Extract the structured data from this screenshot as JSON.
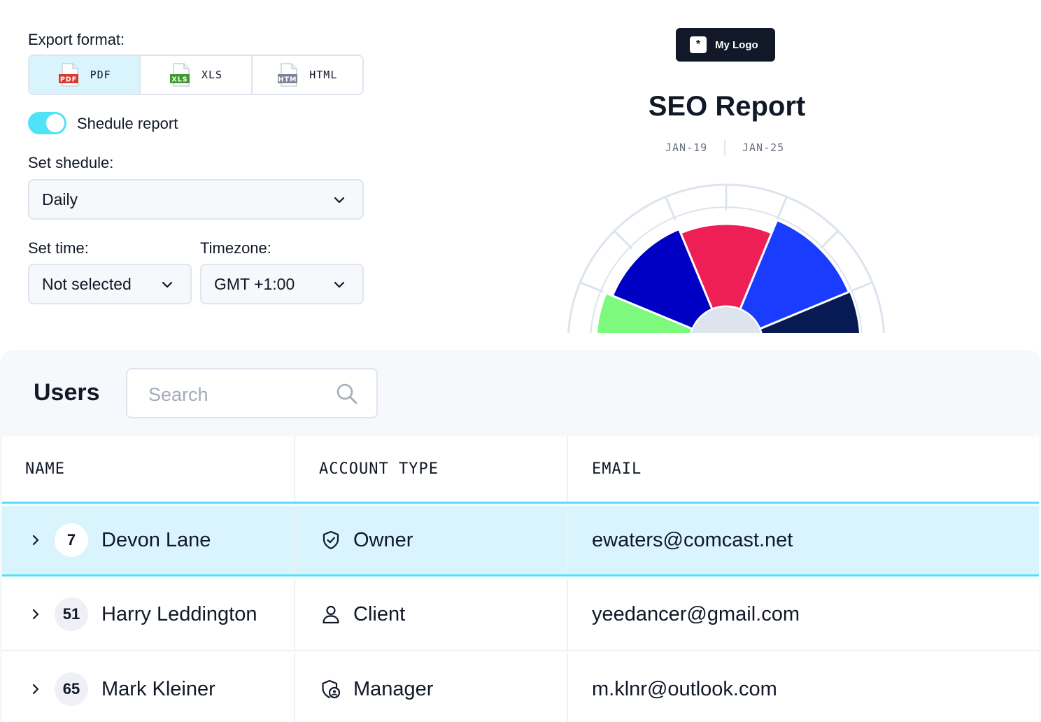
{
  "export": {
    "format_label": "Export format:",
    "formats": [
      {
        "label": "PDF",
        "badge": "PDF",
        "badge_color": "#d83a2f",
        "active": true
      },
      {
        "label": "XLS",
        "badge": "XLS",
        "badge_color": "#3f9a2e",
        "active": false
      },
      {
        "label": "HTML",
        "badge": "HTM",
        "badge_color": "#7a8294",
        "active": false
      }
    ],
    "schedule_toggle_label": "Shedule report",
    "schedule_label": "Set shedule:",
    "schedule_value": "Daily",
    "time_label": "Set time:",
    "time_value": "Not selected",
    "timezone_label": "Timezone:",
    "timezone_value": "GMT +1:00"
  },
  "report": {
    "logo_mark": "*",
    "logo_text": "My Logo",
    "title": "SEO Report",
    "date_start": "JAN-19",
    "date_end": "JAN-25"
  },
  "users": {
    "title": "Users",
    "search_placeholder": "Search",
    "columns": [
      "NAME",
      "ACCOUNT TYPE",
      "EMAIL"
    ],
    "rows": [
      {
        "num": "7",
        "name": "Devon Lane",
        "account_type": "Owner",
        "icon": "shield-check-icon",
        "email": "ewaters@comcast.net"
      },
      {
        "num": "51",
        "name": "Harry Leddington",
        "account_type": "Client",
        "icon": "user-icon",
        "email": "yeedancer@gmail.com"
      },
      {
        "num": "65",
        "name": "Mark Kleiner",
        "account_type": "Manager",
        "icon": "shield-user-icon",
        "email": "m.klnr@outlook.com"
      }
    ]
  },
  "colors": {
    "accent": "#4fe3f7",
    "selected_bg": "#d9f4fd",
    "dark": "#111827",
    "gauge_segments": [
      "#7dfa7e",
      "#0000c4",
      "#ee1f55",
      "#1a3cff",
      "#081a54"
    ],
    "gauge_track": "#dde4ee"
  }
}
